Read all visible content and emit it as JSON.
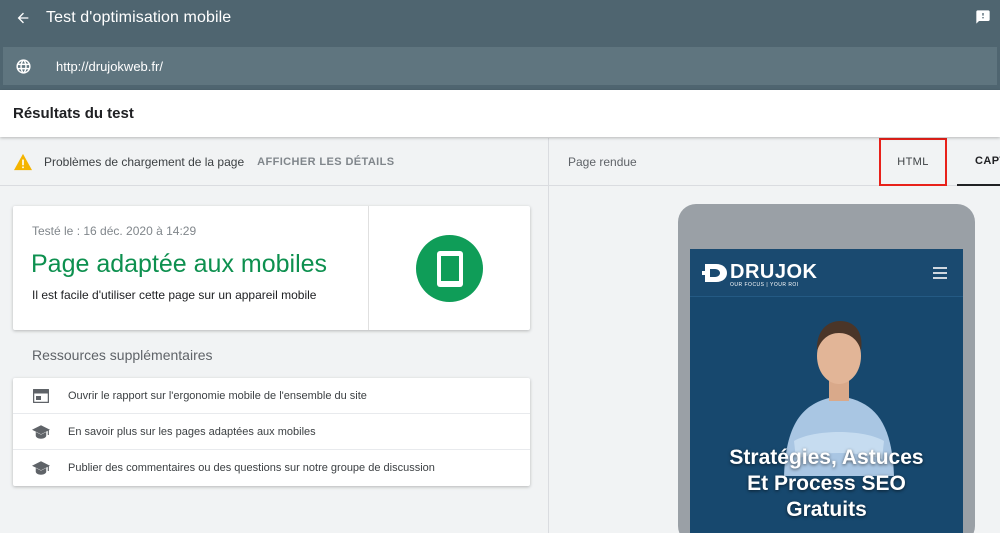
{
  "app": {
    "title": "Test d'optimisation mobile",
    "url": "http://drujokweb.fr/"
  },
  "results": {
    "header": "Résultats du test"
  },
  "warning": {
    "text": "Problèmes de chargement de la page",
    "link": "AFFICHER LES DÉTAILS"
  },
  "result_card": {
    "date": "Testé le : 16 déc. 2020 à 14:29",
    "verdict": "Page adaptée aux mobiles",
    "description": "Il est facile d'utiliser cette page sur un appareil mobile"
  },
  "resources": {
    "title": "Ressources supplémentaires",
    "items": [
      {
        "label": "Ouvrir le rapport sur l'ergonomie mobile de l'ensemble du site",
        "icon": "browser-window-icon"
      },
      {
        "label": "En savoir plus sur les pages adaptées aux mobiles",
        "icon": "graduation-cap-icon"
      },
      {
        "label": "Publier des commentaires ou des questions sur notre groupe de discussion",
        "icon": "graduation-cap-icon"
      }
    ]
  },
  "rendered": {
    "label": "Page rendue",
    "tabs": [
      {
        "label": "HTML"
      },
      {
        "label": "CAPTURE D'ÉCRAN"
      }
    ]
  },
  "preview": {
    "logo": "DRUJOK",
    "tagline": "OUR FOCUS | YOUR ROI",
    "hero_line1": "Stratégies, Astuces",
    "hero_line2": "Et Process SEO",
    "hero_line3": "Gratuits"
  },
  "colors": {
    "appbar": "#4f6570",
    "pass_green": "#0d904f",
    "highlight_red": "#e8211a",
    "warning_yellow": "#f4b400"
  }
}
